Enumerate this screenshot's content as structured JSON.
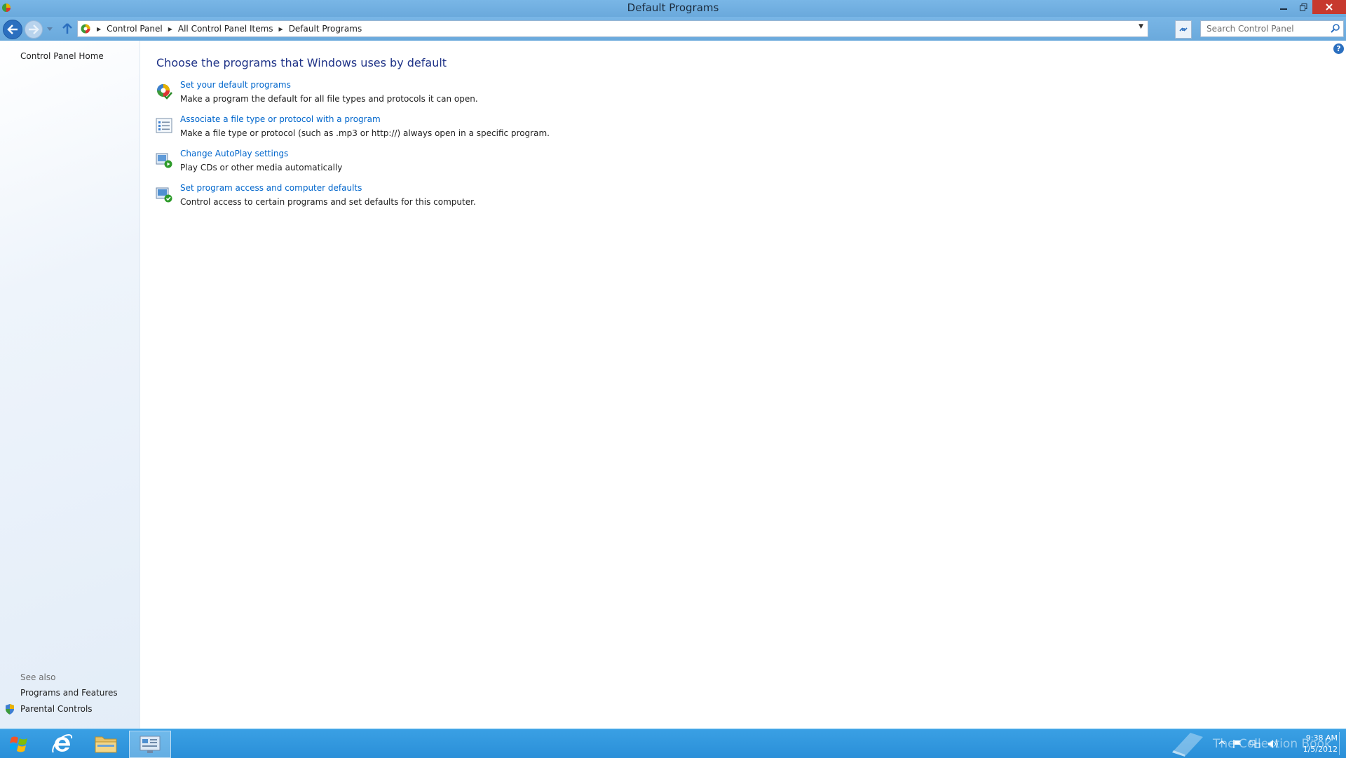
{
  "window": {
    "title": "Default Programs"
  },
  "address": {
    "crumbs": [
      "Control Panel",
      "All Control Panel Items",
      "Default Programs"
    ]
  },
  "search": {
    "placeholder": "Search Control Panel"
  },
  "sidebar": {
    "home_label": "Control Panel Home",
    "see_also_label": "See also",
    "see_also_items": [
      {
        "label": "Programs and Features"
      },
      {
        "label": "Parental Controls"
      }
    ]
  },
  "main": {
    "heading": "Choose the programs that Windows uses by default",
    "tasks": [
      {
        "link": "Set your default programs",
        "desc": "Make a program the default for all file types and protocols it can open.",
        "icon": "default-programs-icon"
      },
      {
        "link": "Associate a file type or protocol with a program",
        "desc": "Make a file type or protocol (such as .mp3 or http://) always open in a specific program.",
        "icon": "file-association-icon"
      },
      {
        "link": "Change AutoPlay settings",
        "desc": "Play CDs or other media automatically",
        "icon": "autoplay-icon"
      },
      {
        "link": "Set program access and computer defaults",
        "desc": "Control access to certain programs and set defaults for this computer.",
        "icon": "program-access-icon"
      }
    ]
  },
  "taskbar": {
    "watermark": "The Collection Book",
    "time": "9:38 AM",
    "date": "1/5/2012"
  },
  "colors": {
    "link": "#0066cc",
    "heading": "#1e3287",
    "titlebar": "#79b6e6",
    "taskbar": "#2a8fd8",
    "close": "#c7392e"
  }
}
